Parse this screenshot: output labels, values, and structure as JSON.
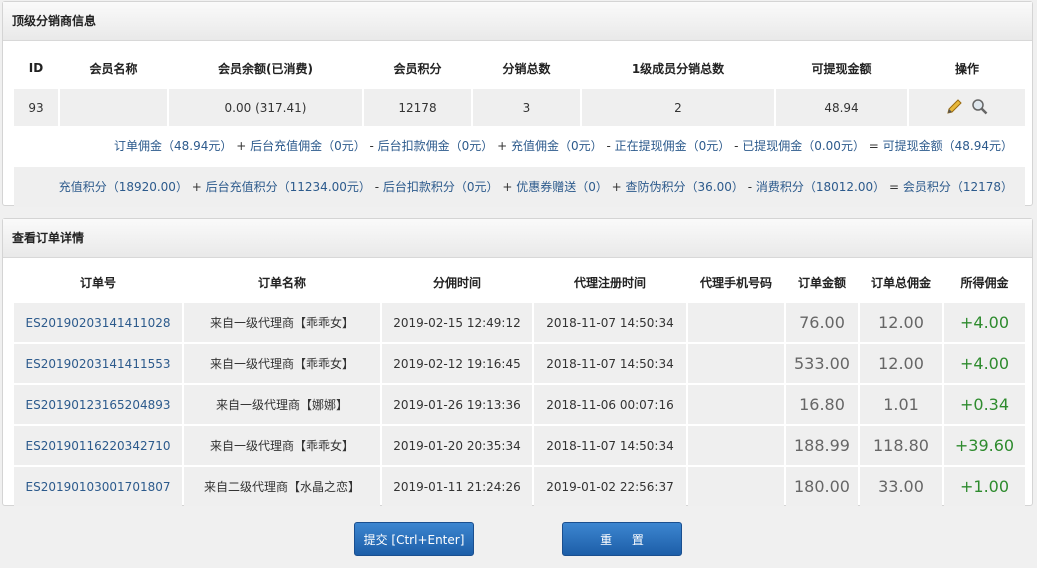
{
  "distributor": {
    "title": "顶级分销商信息",
    "headers": [
      "ID",
      "会员名称",
      "会员余额(已消费)",
      "会员积分",
      "分销总数",
      "1级成员分销总数",
      "可提现金额",
      "操作"
    ],
    "row": {
      "id": "93",
      "name": "",
      "balance": "0.00 (317.41)",
      "points": "12178",
      "total": "3",
      "level1": "2",
      "withdrawable": "48.94"
    },
    "summary1": [
      {
        "t": "订单佣金（48.94元）",
        "b": true
      },
      {
        "t": " + ",
        "b": false
      },
      {
        "t": "后台充值佣金（0元）",
        "b": true
      },
      {
        "t": " - ",
        "b": false
      },
      {
        "t": "后台扣款佣金（0元）",
        "b": true
      },
      {
        "t": " + ",
        "b": false
      },
      {
        "t": "充值佣金（0元）",
        "b": true
      },
      {
        "t": " - ",
        "b": false
      },
      {
        "t": "正在提现佣金（0元）",
        "b": true
      },
      {
        "t": " - ",
        "b": false
      },
      {
        "t": "已提现佣金（0.00元）",
        "b": true
      },
      {
        "t": " = ",
        "b": false
      },
      {
        "t": "可提现金额（48.94元）",
        "b": true
      }
    ],
    "summary2": [
      {
        "t": "充值积分（18920.00）",
        "b": true
      },
      {
        "t": " + ",
        "b": false
      },
      {
        "t": "后台充值积分（11234.00元）",
        "b": true
      },
      {
        "t": " - ",
        "b": false
      },
      {
        "t": "后台扣款积分（0元）",
        "b": true
      },
      {
        "t": " + ",
        "b": false
      },
      {
        "t": "优惠券赠送（0）",
        "b": true
      },
      {
        "t": " + ",
        "b": false
      },
      {
        "t": "查防伪积分（36.00）",
        "b": true
      },
      {
        "t": " - ",
        "b": false
      },
      {
        "t": "消费积分（18012.00）",
        "b": true
      },
      {
        "t": " = ",
        "b": false
      },
      {
        "t": "会员积分（12178）",
        "b": true
      }
    ]
  },
  "orders": {
    "title": "查看订单详情",
    "headers": [
      "订单号",
      "订单名称",
      "分佣时间",
      "代理注册时间",
      "代理手机号码",
      "订单金额",
      "订单总佣金",
      "所得佣金"
    ],
    "rows": [
      {
        "no": "ES20190203141411028",
        "name": "来自一级代理商【乖乖女】",
        "time": "2019-02-15 12:49:12",
        "reg": "2018-11-07 14:50:34",
        "phone": "",
        "amount": "76.00",
        "total": "12.00",
        "gain": "+4.00"
      },
      {
        "no": "ES20190203141411553",
        "name": "来自一级代理商【乖乖女】",
        "time": "2019-02-12 19:16:45",
        "reg": "2018-11-07 14:50:34",
        "phone": "",
        "amount": "533.00",
        "total": "12.00",
        "gain": "+4.00"
      },
      {
        "no": "ES20190123165204893",
        "name": "来自一级代理商【娜娜】",
        "time": "2019-01-26 19:13:36",
        "reg": "2018-11-06 00:07:16",
        "phone": "",
        "amount": "16.80",
        "total": "1.01",
        "gain": "+0.34"
      },
      {
        "no": "ES20190116220342710",
        "name": "来自一级代理商【乖乖女】",
        "time": "2019-01-20 20:35:34",
        "reg": "2018-11-07 14:50:34",
        "phone": "",
        "amount": "188.99",
        "total": "118.80",
        "gain": "+39.60"
      },
      {
        "no": "ES20190103001701807",
        "name": "来自二级代理商【水晶之恋】",
        "time": "2019-01-11 21:24:26",
        "reg": "2019-01-02 22:56:37",
        "phone": "",
        "amount": "180.00",
        "total": "33.00",
        "gain": "+1.00"
      }
    ]
  },
  "buttons": {
    "submit": "提交 [Ctrl+Enter]",
    "reset": "重 置"
  },
  "colors": {
    "link": "#2c5a8c",
    "gain": "#2e8b2e",
    "button": "#2b6fba"
  }
}
